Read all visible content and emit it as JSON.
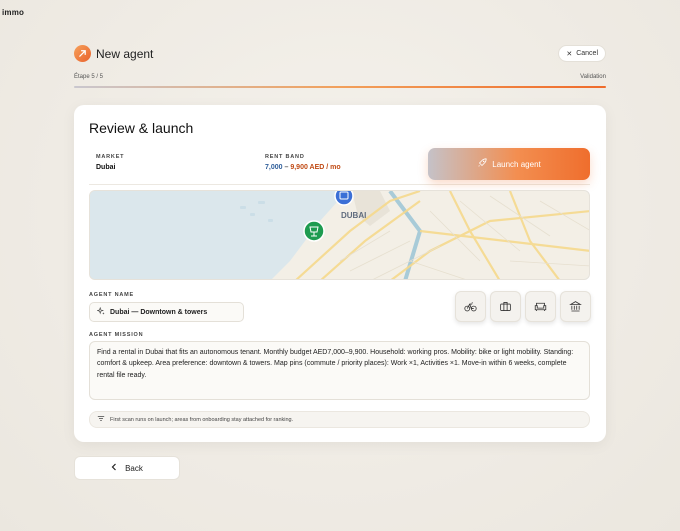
{
  "brand": "immo",
  "header": {
    "title": "New agent",
    "cancel_label": "Cancel"
  },
  "progress": {
    "step_label": "Étape 5 / 5",
    "stage_label": "Validation",
    "value": 1.0
  },
  "card": {
    "title": "Review & launch",
    "market": {
      "label": "MARKET",
      "value": "Dubai"
    },
    "rent": {
      "label": "RENT BAND",
      "min": "7,000",
      "sep": "–",
      "max": "9,900 AED / mo"
    },
    "launch_label": "Launch agent",
    "map": {
      "city_label": "DUBAI"
    },
    "agent_name": {
      "label": "AGENT NAME",
      "value": "Dubai — Downtown & towers"
    },
    "mission": {
      "label": "AGENT MISSION",
      "text": "Find a rental in Dubai that fits an autonomous tenant. Monthly budget AED7,000–9,900. Household: working pros. Mobility: bike or light mobility. Standing: comfort & upkeep. Area preference: downtown & towers. Map pins (commute / priority places): Work ×1, Activities ×1. Move-in within 6 weeks, complete rental file ready."
    },
    "icons": [
      "bicycle-icon",
      "briefcase-icon",
      "sofa-icon",
      "bank-icon"
    ],
    "note": "First scan runs on launch; areas from onboarding stay attached for ranking."
  },
  "back_label": "Back"
}
